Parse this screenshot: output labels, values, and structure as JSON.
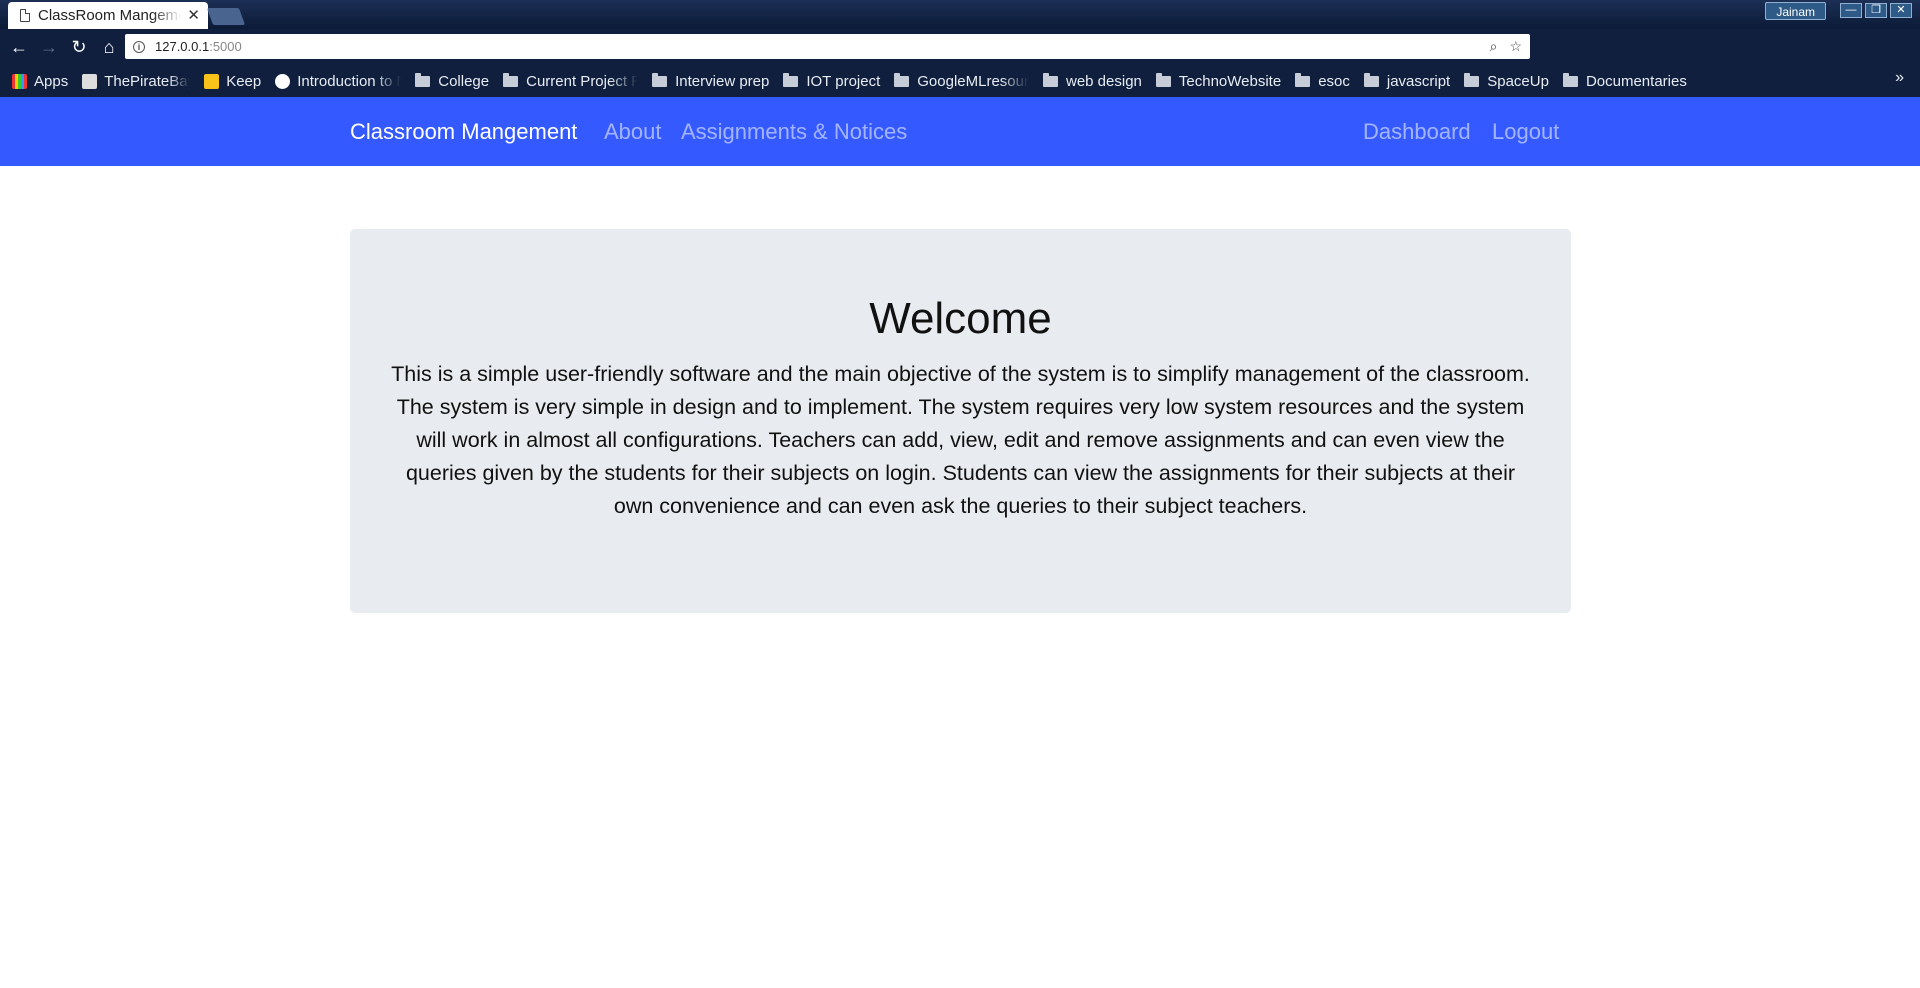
{
  "browser": {
    "tab_title": "ClassRoom Mangement",
    "profile_name": "Jainam",
    "url_host": "127.0.0.1",
    "url_port": ":5000",
    "bookmarks": [
      {
        "label": "Apps",
        "kind": "apps"
      },
      {
        "label": "ThePirateBay-pr",
        "kind": "site"
      },
      {
        "label": "Keep",
        "kind": "site"
      },
      {
        "label": "Introduction to M",
        "kind": "site"
      },
      {
        "label": "College",
        "kind": "folder"
      },
      {
        "label": "Current Project R",
        "kind": "folder"
      },
      {
        "label": "Interview prep",
        "kind": "folder"
      },
      {
        "label": "IOT project",
        "kind": "folder"
      },
      {
        "label": "GoogleMLresour",
        "kind": "folder"
      },
      {
        "label": "web design",
        "kind": "folder"
      },
      {
        "label": "TechnoWebsite",
        "kind": "folder"
      },
      {
        "label": "esoc",
        "kind": "folder"
      },
      {
        "label": "javascript",
        "kind": "folder"
      },
      {
        "label": "SpaceUp",
        "kind": "folder"
      },
      {
        "label": "Documentaries",
        "kind": "folder"
      }
    ],
    "more_bookmarks": "»"
  },
  "site": {
    "brand": "Classroom Mangement",
    "nav_left": [
      "About",
      "Assignments & Notices"
    ],
    "nav_right": [
      "Dashboard",
      "Logout"
    ],
    "accent_color": "#3459ff"
  },
  "hero": {
    "heading": "Welcome",
    "body": "This is a simple user-friendly software and the main objective of the system is to simplify management of the classroom. The system is very simple in design and to implement. The system requires very low system resources and the system will work in almost all configurations. Teachers can add, view, edit and remove assignments and can even view the queries given by the students for their subjects on login. Students can view the assignments for their subjects at their own convenience and can even ask the queries to their subject teachers."
  }
}
